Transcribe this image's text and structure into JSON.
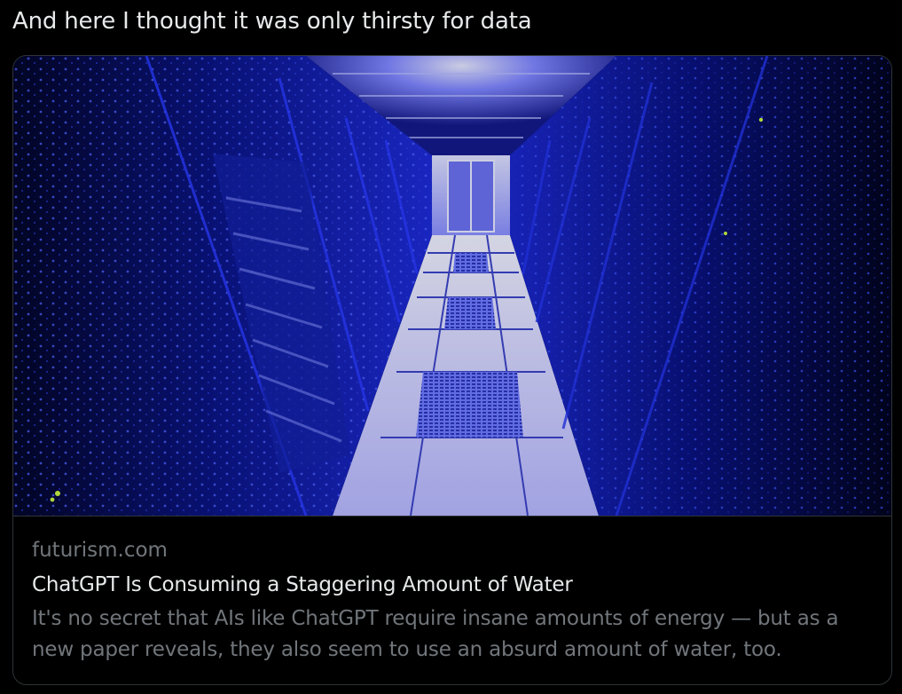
{
  "tweet": {
    "text": "And here I thought it was only thirsty for data"
  },
  "card": {
    "image_icon": "server-room-photo",
    "domain": "futurism.com",
    "title": "ChatGPT Is Consuming a Staggering Amount of Water",
    "description": "It's no secret that AIs like ChatGPT require insane amounts of energy — but as a new paper reveals, they also seem to use an absurd amount of water, too."
  },
  "colors": {
    "background": "#000000",
    "primary_text": "#e7e9ea",
    "secondary_text": "#71767b",
    "border": "#2f3336",
    "image_accent": "#2a3cff"
  }
}
